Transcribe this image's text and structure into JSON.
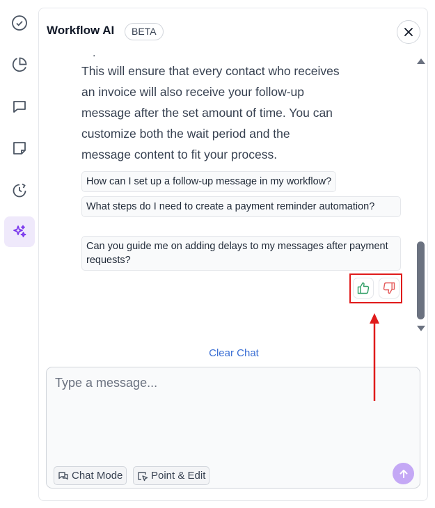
{
  "sidebar": {
    "items": [
      {
        "icon": "check-circle-icon"
      },
      {
        "icon": "pie-chart-icon"
      },
      {
        "icon": "chat-bubble-icon"
      },
      {
        "icon": "note-icon"
      },
      {
        "icon": "history-icon"
      },
      {
        "icon": "sparkle-icon",
        "active": true
      }
    ]
  },
  "header": {
    "title": "Workflow AI",
    "badge": "BETA",
    "close_icon": "close-icon"
  },
  "chat": {
    "partial_line": ".",
    "message_lines": [
      "This will ensure that every contact who receives",
      "an invoice will also receive your follow-up",
      "message after the set amount of time. You can",
      "customize both the wait period and the",
      "message content to fit your process."
    ],
    "suggestions": [
      "How can I set up a follow-up message in my workflow?",
      "What steps do I need to create a payment reminder automation?",
      "Can you guide me on adding delays to my messages after payment requests?"
    ],
    "feedback": {
      "thumbs_up_icon": "thumbs-up-icon",
      "thumbs_down_icon": "thumbs-down-icon",
      "up_color": "#2f9e65",
      "down_color": "#e45757",
      "highlight_color": "#e01b1b"
    }
  },
  "clear_chat_label": "Clear Chat",
  "composer": {
    "placeholder": "Type a message...",
    "value": "",
    "chat_mode_label": "Chat Mode",
    "point_edit_label": "Point & Edit",
    "send_icon": "arrow-up-icon"
  },
  "colors": {
    "accent": "#8b5cf6",
    "link": "#3b6fd4",
    "send_bg": "#c4a8f5"
  }
}
